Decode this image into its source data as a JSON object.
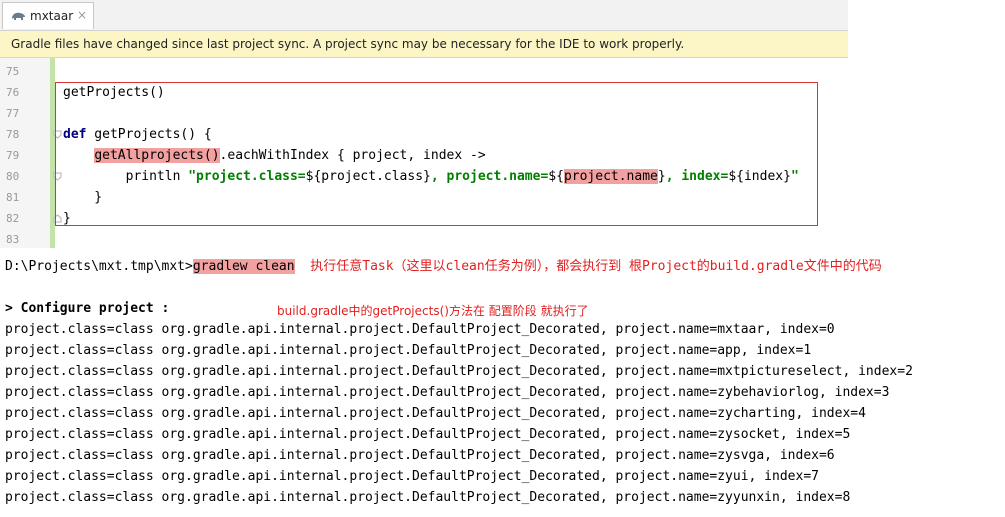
{
  "tab": {
    "title": "mxtaar",
    "icon": "gradle-elephant-icon",
    "close": "×"
  },
  "notification": {
    "text": "Gradle files have changed since last project sync. A project sync may be necessary for the IDE to work properly."
  },
  "editor": {
    "line_numbers": [
      "75",
      "76",
      "77",
      "78",
      "79",
      "80",
      "81",
      "82",
      "83"
    ],
    "l76": "getProjects()",
    "l78_kw": "def",
    "l78_rest": " getProjects() {",
    "l79_indent": "    ",
    "l79_hl": "getAllprojects()",
    "l79_rest": ".eachWithIndex { project, index ->",
    "l80_indent": "        println ",
    "l80_s1": "\"project.class=",
    "l80_v1": "${project.class}",
    "l80_s2": ", project.name=",
    "l80_v2a": "${",
    "l80_hl": "project.name",
    "l80_v2b": "}",
    "l80_s3": ", index=",
    "l80_v3": "${index}",
    "l80_s4": "\"",
    "l81": "    }",
    "l82": "}"
  },
  "console": {
    "prompt": "D:\\Projects\\mxt.tmp\\mxt>",
    "command": "gradlew clean",
    "annotation": "执行任意Task（这里以clean任务为例），都会执行到 根Project的build.gradle文件中的代码",
    "configure": "> Configure project :",
    "note": "build.gradle中的getProjects()方法在 配置阶段 就执行了",
    "output": [
      "project.class=class org.gradle.api.internal.project.DefaultProject_Decorated, project.name=mxtaar, index=0",
      "project.class=class org.gradle.api.internal.project.DefaultProject_Decorated, project.name=app, index=1",
      "project.class=class org.gradle.api.internal.project.DefaultProject_Decorated, project.name=mxtpictureselect, index=2",
      "project.class=class org.gradle.api.internal.project.DefaultProject_Decorated, project.name=zybehaviorlog, index=3",
      "project.class=class org.gradle.api.internal.project.DefaultProject_Decorated, project.name=zycharting, index=4",
      "project.class=class org.gradle.api.internal.project.DefaultProject_Decorated, project.name=zysocket, index=5",
      "project.class=class org.gradle.api.internal.project.DefaultProject_Decorated, project.name=zysvga, index=6",
      "project.class=class org.gradle.api.internal.project.DefaultProject_Decorated, project.name=zyui, index=7",
      "project.class=class org.gradle.api.internal.project.DefaultProject_Decorated, project.name=zyyunxin, index=8"
    ]
  },
  "colors": {
    "annotation_red": "#e21f1f",
    "highlight": "#f2a0a0",
    "notification_bg": "#fcf6c6",
    "keyword": "#000080",
    "string": "#008000"
  }
}
